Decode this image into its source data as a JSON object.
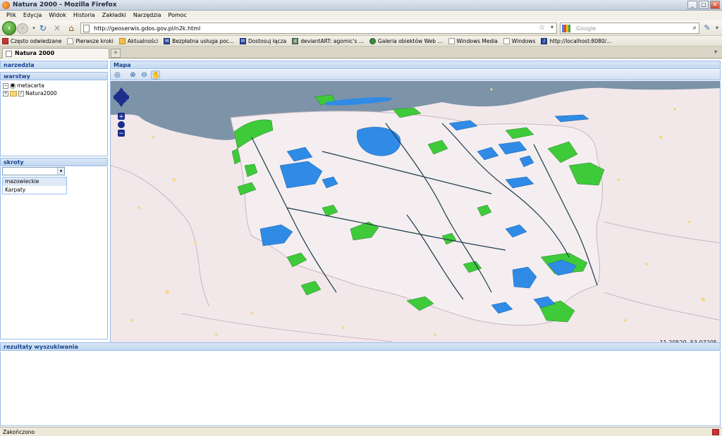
{
  "window": {
    "title": "Natura 2000 - Mozilla Firefox",
    "buttons": [
      "_",
      "□",
      "✕"
    ]
  },
  "menu": [
    "Plik",
    "Edycja",
    "Widok",
    "Historia",
    "Zakładki",
    "Narzędzia",
    "Pomoc"
  ],
  "nav": {
    "url": "http://geoserwis.gdos.gov.pl/n2k.html",
    "search_placeholder": "Google"
  },
  "bookmarks": [
    "Często odwiedzane",
    "Pierwsze kroki",
    "Aktualności",
    "Bezpłatna usługa poc...",
    "Dostosuj łącza",
    "deviantART: agomic's ...",
    "Galeria obiektów Web ...",
    "Windows Media",
    "Windows",
    "http://localhost:8080/..."
  ],
  "tab": {
    "label": "Natura 2000",
    "new_tab": "+"
  },
  "panels": {
    "tools": "narzedzia",
    "layers": "warstwy",
    "layer_items": [
      "metacarta",
      "Natura2000"
    ],
    "shortcuts": "skroty",
    "shortcut_options": [
      "mazowieckie",
      "Karpaty"
    ],
    "combo_value": "",
    "results": "rezultaty wyszukiwania",
    "map": "Mapa"
  },
  "map": {
    "coordinates": "11.20520, 53.97205",
    "colors": {
      "land": "#f2e8ea",
      "sea": "#7d93a8",
      "green_sites": "#3fca3a",
      "blue_sites": "#2f8be6",
      "rivers": "#1a3a4a"
    }
  },
  "status": {
    "text": "Zakończono"
  }
}
